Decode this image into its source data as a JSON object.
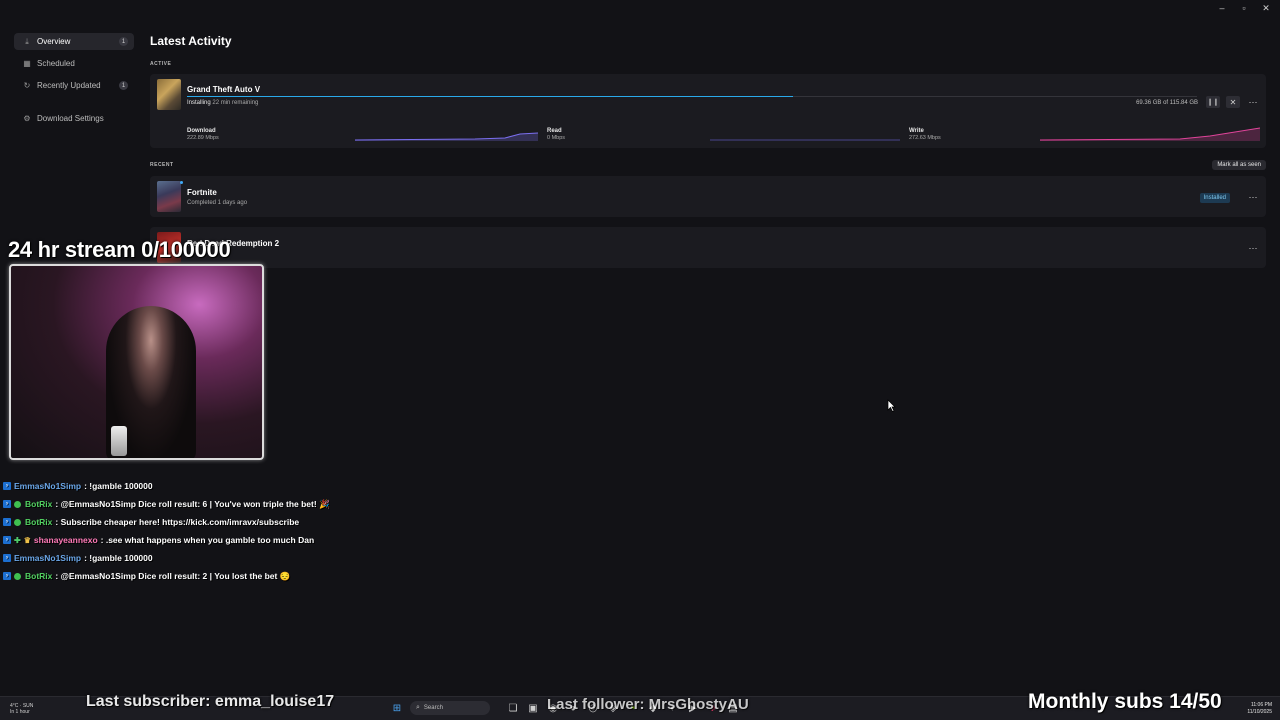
{
  "window_controls": [
    "–",
    "▫",
    "✕"
  ],
  "sidebar": {
    "items": [
      {
        "label": "Overview",
        "icon": "download-icon",
        "badge": "1"
      },
      {
        "label": "Scheduled",
        "icon": "calendar-icon",
        "badge": ""
      },
      {
        "label": "Recently Updated",
        "icon": "refresh-icon",
        "badge": "1"
      },
      {
        "label": "Download Settings",
        "icon": "gear-icon",
        "badge": ""
      }
    ]
  },
  "main": {
    "title": "Latest Activity",
    "active_label": "ACTIVE",
    "recent_label": "RECENT",
    "mark_all_seen": "Mark all as seen",
    "active": {
      "name": "Grand Theft Auto V",
      "status": "Installing",
      "remaining": "22 min remaining",
      "size": "69.36 GB of 115.84 GB",
      "progress": 0.6,
      "metrics": [
        {
          "label": "Download",
          "value": "222.89 Mbps"
        },
        {
          "label": "Read",
          "value": "0 Mbps"
        },
        {
          "label": "Write",
          "value": "272.63 Mbps"
        }
      ]
    },
    "recent": [
      {
        "name": "Fortnite",
        "status": "Completed 1 days ago",
        "badge": "Installed"
      },
      {
        "name": "Red Dead Redemption 2",
        "status": "",
        "badge": ""
      }
    ]
  },
  "stream": {
    "title": "24 hr stream 0/100000",
    "chat": [
      {
        "user": "EmmasNo1Simp",
        "message": ": !gamble 100000",
        "type": "user"
      },
      {
        "user": "BotRix",
        "message": ": @EmmasNo1Simp Dice roll result: 6 | You've won triple the bet! 🎉",
        "type": "bot"
      },
      {
        "user": "BotRix",
        "message": ": Subscribe cheaper here! https://kick.com/imravx/subscribe",
        "type": "bot"
      },
      {
        "user": "shanayeannexo",
        "message": ": .see what happens when you gamble too much Dan",
        "type": "follower"
      },
      {
        "user": "EmmasNo1Simp",
        "message": ": !gamble 100000",
        "type": "user"
      },
      {
        "user": "BotRix",
        "message": ": @EmmasNo1Simp Dice roll result: 2 | You lost the bet 😔",
        "type": "bot"
      }
    ],
    "last_subscriber": "Last subscriber: emma_louise17",
    "last_follower": "Last follower: MrsGhostyAU",
    "monthly_subs": "Monthly subs 14/50"
  },
  "taskbar": {
    "weather": "4°C · SUN\nIn 1 hour",
    "search_placeholder": "Search",
    "time": "11:06 PM",
    "date": "11/10/2025"
  },
  "colors": {
    "progress": "#2aa9ea",
    "download_graph": "#7b6ff0",
    "write_graph": "#e0449a",
    "installed": "#7ec8ef"
  }
}
